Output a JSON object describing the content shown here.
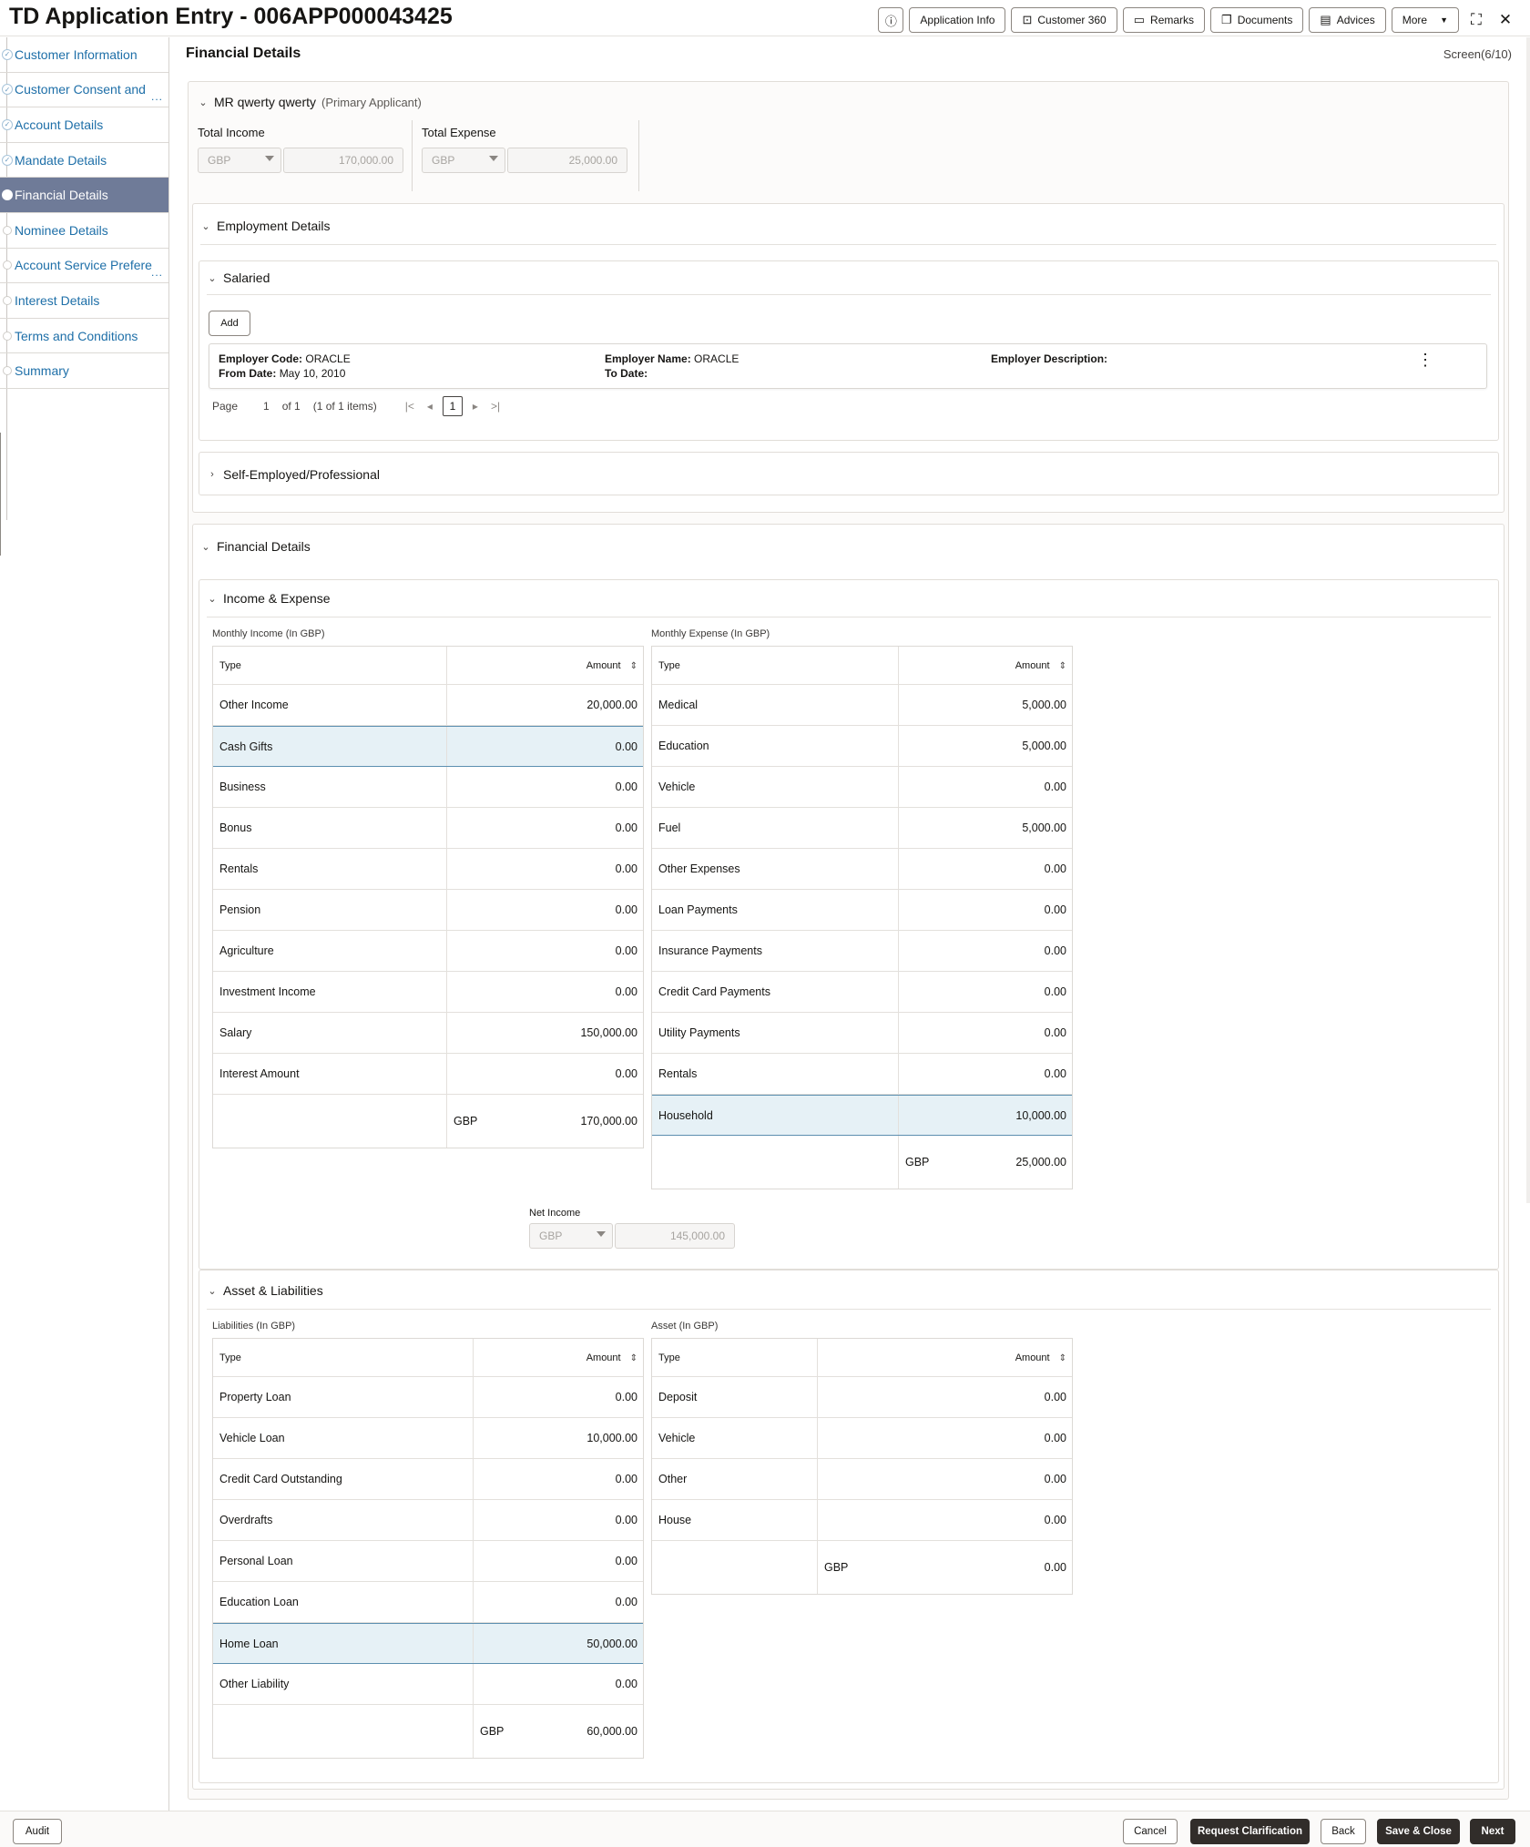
{
  "header": {
    "title": "TD Application Entry - 006APP000043425",
    "buttons": {
      "info_icon": "info-icon",
      "application_info": "Application Info",
      "customer_360": "Customer 360",
      "remarks": "Remarks",
      "documents": "Documents",
      "advices": "Advices",
      "more": "More"
    }
  },
  "sidebar": {
    "items": [
      {
        "label": "Customer Information",
        "state": "visited"
      },
      {
        "label": "Customer Consent and",
        "state": "visited"
      },
      {
        "label": "Account Details",
        "state": "visited"
      },
      {
        "label": "Mandate Details",
        "state": "visited"
      },
      {
        "label": "Financial Details",
        "state": "active"
      },
      {
        "label": "Nominee Details",
        "state": "pending"
      },
      {
        "label": "Account Service Prefere",
        "state": "pending"
      },
      {
        "label": "Interest Details",
        "state": "pending"
      },
      {
        "label": "Terms and Conditions",
        "state": "pending"
      },
      {
        "label": "Summary",
        "state": "pending"
      }
    ],
    "more_indicator": "..."
  },
  "page": {
    "title": "Financial Details",
    "screen": "Screen(6/10)"
  },
  "applicant": {
    "name": "MR qwerty qwerty",
    "role": "(Primary Applicant)",
    "total_income": {
      "label": "Total Income",
      "currency": "GBP",
      "amount": "170,000.00"
    },
    "total_expense": {
      "label": "Total Expense",
      "currency": "GBP",
      "amount": "25,000.00"
    }
  },
  "employment": {
    "title": "Employment Details",
    "salaried": {
      "title": "Salaried",
      "add_label": "Add",
      "record": {
        "code_label": "Employer Code:",
        "code": "ORACLE",
        "from_label": "From Date:",
        "from": "May 10, 2010",
        "name_label": "Employer Name:",
        "name": "ORACLE",
        "to_label": "To Date:",
        "to": "",
        "desc_label": "Employer Description:",
        "desc": ""
      },
      "pager": {
        "page_label": "Page",
        "page": "1",
        "of": "of 1",
        "items": "(1 of 1 items)",
        "current": "1"
      }
    },
    "self_employed": {
      "title": "Self-Employed/Professional"
    }
  },
  "financial": {
    "title": "Financial Details",
    "income_expense": {
      "title": "Income & Expense",
      "income": {
        "caption": "Monthly Income (In GBP)",
        "col_type": "Type",
        "col_amount": "Amount",
        "rows": [
          {
            "type": "Other Income",
            "amount": "20,000.00"
          },
          {
            "type": "Cash Gifts",
            "amount": "0.00",
            "hl": true
          },
          {
            "type": "Business",
            "amount": "0.00"
          },
          {
            "type": "Bonus",
            "amount": "0.00"
          },
          {
            "type": "Rentals",
            "amount": "0.00"
          },
          {
            "type": "Pension",
            "amount": "0.00"
          },
          {
            "type": "Agriculture",
            "amount": "0.00"
          },
          {
            "type": "Investment Income",
            "amount": "0.00"
          },
          {
            "type": "Salary",
            "amount": "150,000.00"
          },
          {
            "type": "Interest Amount",
            "amount": "0.00"
          }
        ],
        "footer_currency": "GBP",
        "footer_total": "170,000.00"
      },
      "expense": {
        "caption": "Monthly Expense (In GBP)",
        "col_type": "Type",
        "col_amount": "Amount",
        "rows": [
          {
            "type": "Medical",
            "amount": "5,000.00"
          },
          {
            "type": "Education",
            "amount": "5,000.00"
          },
          {
            "type": "Vehicle",
            "amount": "0.00"
          },
          {
            "type": "Fuel",
            "amount": "5,000.00"
          },
          {
            "type": "Other Expenses",
            "amount": "0.00"
          },
          {
            "type": "Loan Payments",
            "amount": "0.00"
          },
          {
            "type": "Insurance Payments",
            "amount": "0.00"
          },
          {
            "type": "Credit Card Payments",
            "amount": "0.00"
          },
          {
            "type": "Utility Payments",
            "amount": "0.00"
          },
          {
            "type": "Rentals",
            "amount": "0.00"
          },
          {
            "type": "Household",
            "amount": "10,000.00",
            "hl": true
          }
        ],
        "footer_currency": "GBP",
        "footer_total": "25,000.00"
      },
      "net_income": {
        "label": "Net Income",
        "currency": "GBP",
        "amount": "145,000.00"
      }
    },
    "assets_liabilities": {
      "title": "Asset & Liabilities",
      "liabilities": {
        "caption": "Liabilities (In GBP)",
        "col_type": "Type",
        "col_amount": "Amount",
        "rows": [
          {
            "type": "Property Loan",
            "amount": "0.00"
          },
          {
            "type": "Vehicle Loan",
            "amount": "10,000.00"
          },
          {
            "type": "Credit Card Outstanding",
            "amount": "0.00"
          },
          {
            "type": "Overdrafts",
            "amount": "0.00"
          },
          {
            "type": "Personal Loan",
            "amount": "0.00"
          },
          {
            "type": "Education Loan",
            "amount": "0.00"
          },
          {
            "type": "Home Loan",
            "amount": "50,000.00",
            "hl": true
          },
          {
            "type": "Other Liability",
            "amount": "0.00"
          }
        ],
        "footer_currency": "GBP",
        "footer_total": "60,000.00"
      },
      "assets": {
        "caption": "Asset (In GBP)",
        "col_type": "Type",
        "col_amount": "Amount",
        "rows": [
          {
            "type": "Deposit",
            "amount": "0.00"
          },
          {
            "type": "Vehicle",
            "amount": "0.00"
          },
          {
            "type": "Other",
            "amount": "0.00"
          },
          {
            "type": "House",
            "amount": "0.00"
          }
        ],
        "footer_currency": "GBP",
        "footer_total": "0.00"
      }
    }
  },
  "footer": {
    "audit": "Audit",
    "cancel": "Cancel",
    "request_clarification": "Request Clarification",
    "back": "Back",
    "save_close": "Save & Close",
    "next": "Next"
  }
}
